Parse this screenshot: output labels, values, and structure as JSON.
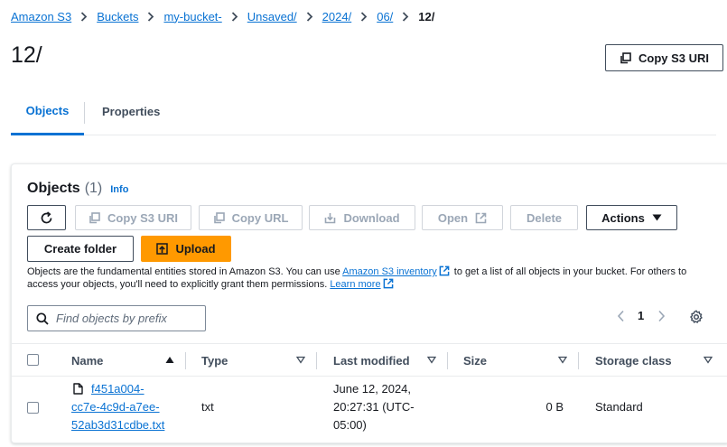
{
  "breadcrumb": {
    "items": [
      "Amazon S3",
      "Buckets",
      "my-bucket-",
      "Unsaved/",
      "2024/",
      "06/"
    ],
    "current": "12/"
  },
  "page": {
    "title": "12/",
    "copy_s3_uri": "Copy S3 URI"
  },
  "tabs": {
    "objects": "Objects",
    "properties": "Properties"
  },
  "objects": {
    "title": "Objects",
    "count": "(1)",
    "info": "Info",
    "toolbar": {
      "copy_s3_uri": "Copy S3 URI",
      "copy_url": "Copy URL",
      "download": "Download",
      "open": "Open",
      "delete": "Delete",
      "actions": "Actions",
      "create_folder": "Create folder",
      "upload": "Upload"
    },
    "description": {
      "part1": "Objects are the fundamental entities stored in Amazon S3. You can use ",
      "link1": "Amazon S3 inventory",
      "part2": " to get a list of all objects in your bucket. For others to access your objects, you'll need to explicitly grant them permissions. ",
      "link2": "Learn more"
    },
    "search_placeholder": "Find objects by prefix",
    "pagination": {
      "current_page": "1"
    },
    "columns": [
      "Name",
      "Type",
      "Last modified",
      "Size",
      "Storage class"
    ],
    "rows": [
      {
        "name_lines": [
          "f451a004-",
          "cc7e-4c9d-a7ee-",
          "52ab3d31cdbe.txt"
        ],
        "type": "txt",
        "last_modified_lines": [
          "June 12, 2024,",
          "20:27:31 (UTC-",
          "05:00)"
        ],
        "size": "0 B",
        "storage_class": "Standard"
      }
    ]
  },
  "colors": {
    "link": "#0972d3",
    "primary": "#ff9900",
    "text": "#16191f",
    "disabled": "#9ba7b6"
  }
}
